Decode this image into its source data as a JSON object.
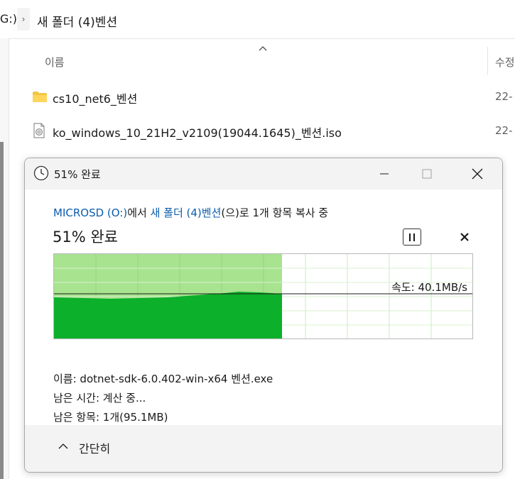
{
  "explorer": {
    "breadcrumb": {
      "drive": "G:)",
      "separator": "›",
      "folder": "새 폴더 (4)벤션"
    },
    "columns": {
      "name": "이름",
      "sort_indicator": "^",
      "modified": "수정"
    },
    "files": [
      {
        "name": "cs10_net6_벤션",
        "type": "folder",
        "date": "22-"
      },
      {
        "name": "ko_windows_10_21H2_v2109(19044.1645)_벤션.iso",
        "type": "iso",
        "date": "22-"
      }
    ]
  },
  "copy_dialog": {
    "title": "51% 완료",
    "description": {
      "source": "MICROSD (O:)",
      "source_suffix": "에서 ",
      "destination": "새 폴더 (4)벤션",
      "rest": "(으)로 1개 항목 복사 중"
    },
    "heading": "51% 완료",
    "progress_percent": 51,
    "speed_label": "속도: 40.1MB/s",
    "details": {
      "name": "이름: dotnet-sdk-6.0.402-win-x64 벤션.exe",
      "time_remaining": "남은 시간: 계산 중...",
      "items_remaining": "남은 항목: 1개(95.1MB)"
    },
    "footer_label": "간단히",
    "colors": {
      "fill_light": "#a8e38f",
      "fill_dark": "#0db02b",
      "grid": "#c9ecbc",
      "link": "#0b5cad"
    }
  }
}
